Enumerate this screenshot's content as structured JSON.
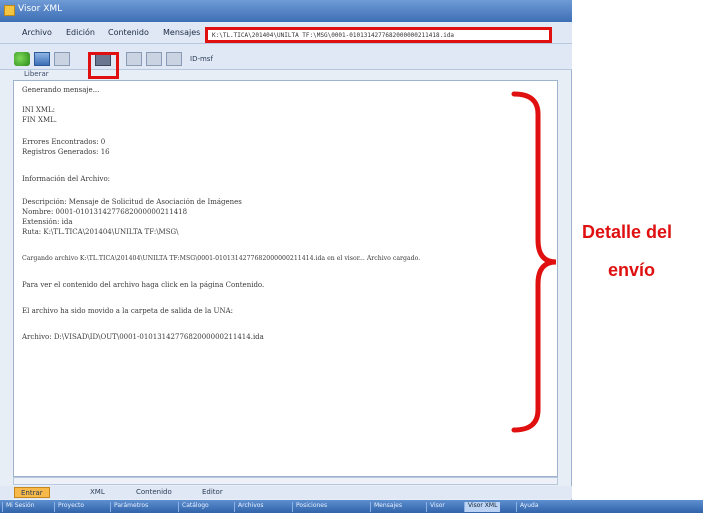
{
  "window": {
    "title": "Visor XML"
  },
  "menu": [
    "Archivo",
    "Edición",
    "Contenido",
    "Mensajes"
  ],
  "path": "K:\\TL.TICA\\201404\\UNILTA TF:\\MSG\\0001-0101314277682000000211418.ida",
  "toolbar": {
    "dropdown_label": "ID-msf",
    "subtab": "Liberar"
  },
  "content": {
    "lines": [
      "Generando mensaje...",
      "INI XML:",
      "FIN XML.",
      "Errores Encontrados: 0",
      "Registros Generados: 16",
      "Información del Archivo:",
      "Descripción:      Mensaje de Solicitud de Asociación de Imágenes",
      "Nombre:           0001-0101314277682000000211418",
      "Extensión:        ida",
      "Ruta:             K:\\TL.TICA\\201404\\UNILTA TF:\\MSG\\",
      "Cargando archivo K:\\TL.TICA\\201404\\UNILTA TF:MSG\\0001-0101314277682000000211414.ida en el visor... Archivo cargado.",
      "Para ver el contenido del archivo haga click en la página Contenido.",
      "El archivo ha sido movido a la carpeta de salida de la UNA:",
      "Archivo:          D:\\VISAD\\ID\\OUT\\0001-0101314277682000000211414.ida"
    ]
  },
  "bottom_tabs": [
    "Entrar",
    "XML",
    "Contenido",
    "Editor"
  ],
  "taskbar": [
    "Mi Sesión",
    "Proyecto",
    "Parámetros",
    "Catálogo",
    "Archivos",
    "Posiciones",
    "Mensajes",
    "Visor",
    "Visor XML",
    "Ayuda"
  ],
  "annotation": {
    "line1": "Detalle del",
    "line2": "envío"
  },
  "colors": {
    "highlight": "#e01010",
    "active_tab": "#f6b94a"
  }
}
